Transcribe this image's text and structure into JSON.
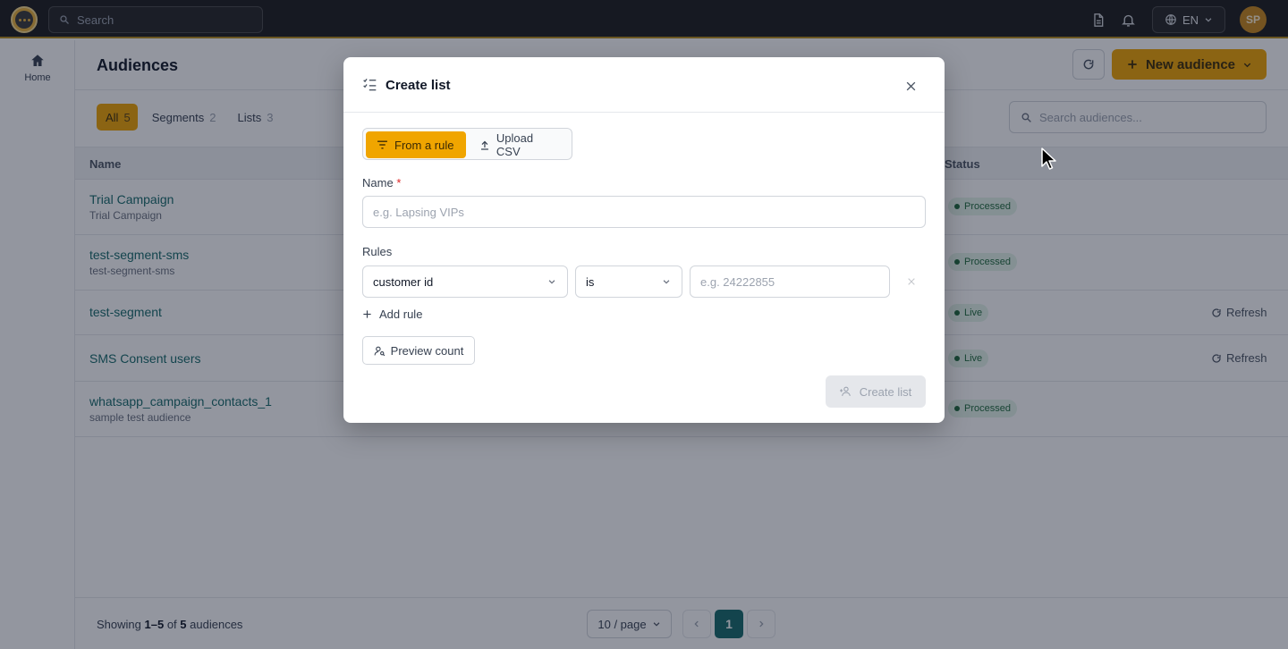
{
  "topbar": {
    "search_placeholder": "Search",
    "lang_label": "EN",
    "avatar_initials": "SP"
  },
  "sidebar": {
    "items": [
      {
        "label": "Home",
        "icon": "home-icon"
      }
    ]
  },
  "page": {
    "title": "Audiences",
    "new_button_label": "New audience",
    "filters": [
      {
        "label": "All",
        "count": "5",
        "active": true
      },
      {
        "label": "Segments",
        "count": "2",
        "active": false
      },
      {
        "label": "Lists",
        "count": "3",
        "active": false
      }
    ],
    "search_placeholder": "Search audiences..."
  },
  "table": {
    "headers": {
      "name": "Name",
      "status": "Status"
    },
    "rows": [
      {
        "name": "Trial Campaign",
        "subtitle": "Trial Campaign",
        "status": "Processed",
        "action": ""
      },
      {
        "name": "test-segment-sms",
        "subtitle": "test-segment-sms",
        "status": "Processed",
        "action": ""
      },
      {
        "name": "test-segment",
        "subtitle": "",
        "status": "Live",
        "action": "Refresh"
      },
      {
        "name": "SMS Consent users",
        "subtitle": "",
        "status": "Live",
        "action": "Refresh"
      },
      {
        "name": "whatsapp_campaign_contacts_1",
        "subtitle": "sample test audience",
        "status": "Processed",
        "action": ""
      }
    ]
  },
  "footer": {
    "showing_prefix": "Showing",
    "showing_range": "1–5",
    "showing_of": "of",
    "showing_total": "5",
    "showing_suffix": "audiences",
    "per_page": "10 / page",
    "current_page": "1"
  },
  "modal": {
    "title": "Create list",
    "tab_rule": "From a rule",
    "tab_csv": "Upload CSV",
    "name_label": "Name",
    "name_required": "*",
    "name_placeholder": "e.g. Lapsing VIPs",
    "rules_label": "Rules",
    "rule_field": "customer id",
    "rule_operator": "is",
    "rule_value_placeholder": "e.g. 24222855",
    "add_rule": "Add rule",
    "preview_count": "Preview count",
    "create_button": "Create list"
  },
  "colors": {
    "accent": "#f0a500",
    "teal": "#176b6b",
    "topbar": "#1c1c1c",
    "badge_bg": "#e3f4ea"
  }
}
